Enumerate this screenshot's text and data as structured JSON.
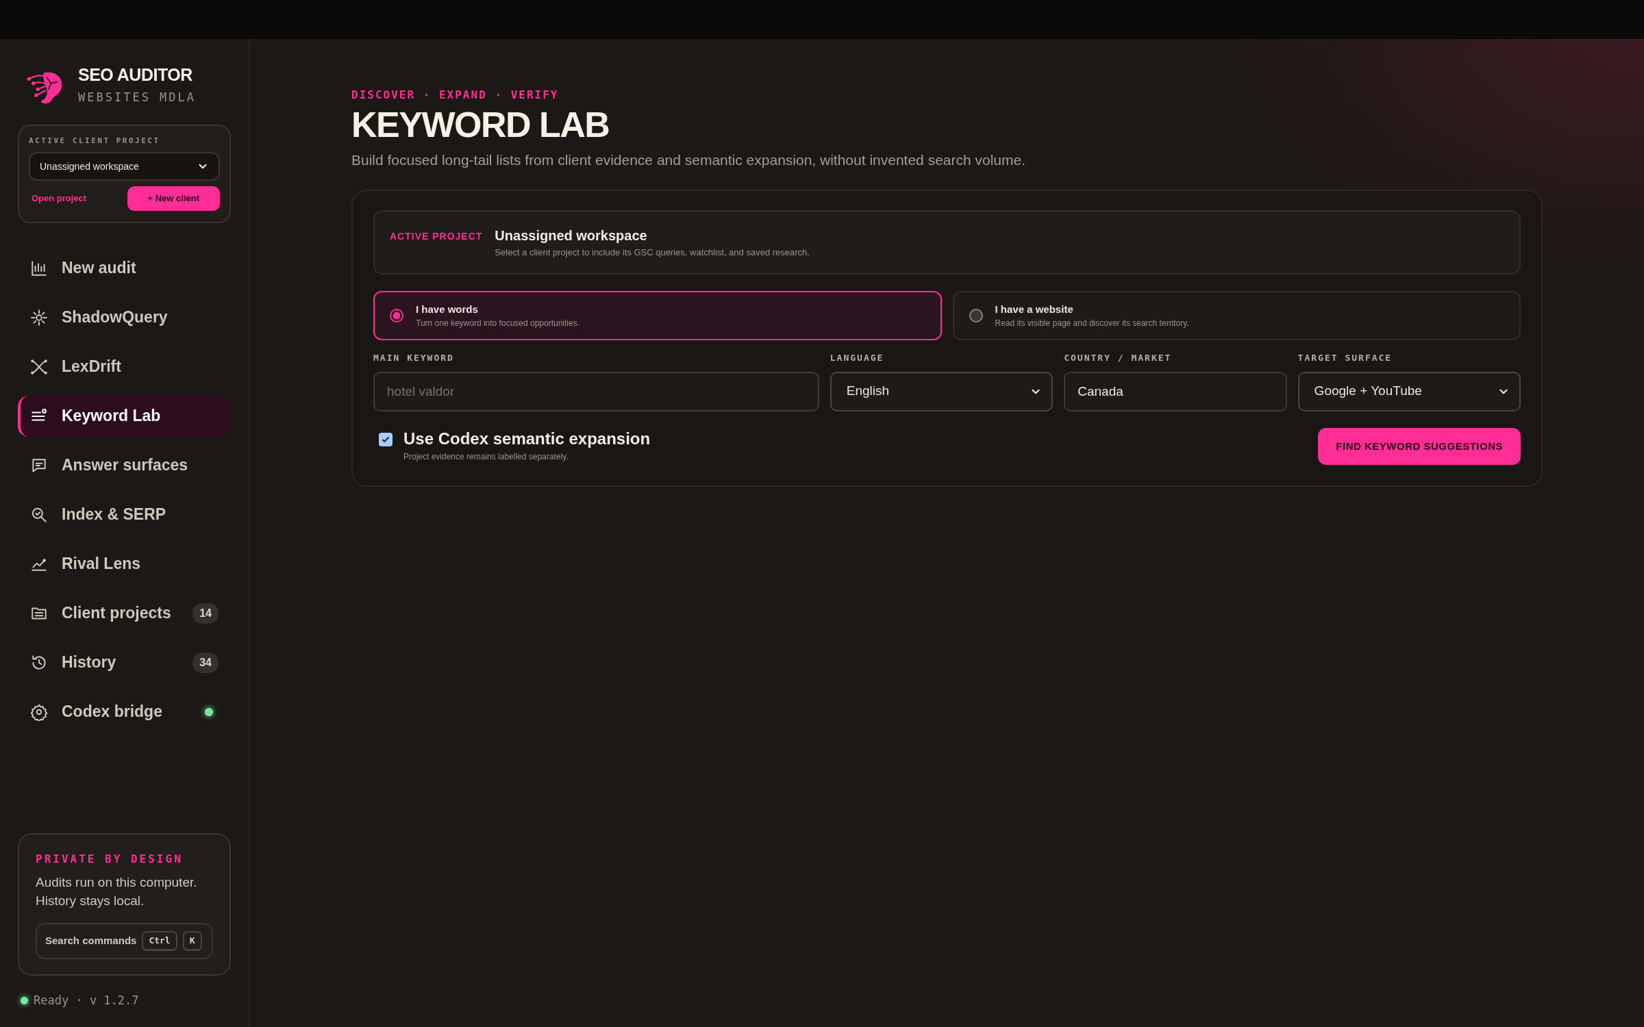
{
  "brand": {
    "name": "SEO AUDITOR",
    "subtitle": "WEBSITES MDLA"
  },
  "project_picker": {
    "label": "ACTIVE CLIENT PROJECT",
    "value": "Unassigned workspace",
    "open_link": "Open project",
    "new_button": "+ New client"
  },
  "nav": [
    {
      "label": "New audit",
      "kind": "plain",
      "selected": false
    },
    {
      "label": "ShadowQuery",
      "kind": "plain",
      "selected": false
    },
    {
      "label": "LexDrift",
      "kind": "plain",
      "selected": false
    },
    {
      "label": "Keyword Lab",
      "kind": "plain",
      "selected": true
    },
    {
      "label": "Answer surfaces",
      "kind": "plain",
      "selected": false
    },
    {
      "label": "Index & SERP",
      "kind": "plain",
      "selected": false
    },
    {
      "label": "Rival Lens",
      "kind": "plain",
      "selected": false
    },
    {
      "label": "Client projects",
      "kind": "count",
      "badge": "14",
      "selected": false
    },
    {
      "label": "History",
      "kind": "count",
      "badge": "34",
      "selected": false
    },
    {
      "label": "Codex bridge",
      "kind": "status",
      "online": true,
      "selected": false
    }
  ],
  "privacy": {
    "title": "PRIVATE BY DESIGN",
    "text": "Audits run on this computer. History stays local.",
    "search_label": "Search commands",
    "keys": [
      "Ctrl",
      "K"
    ]
  },
  "status": {
    "online": true,
    "text": "Ready · v 1.2.7"
  },
  "header": {
    "eyebrow": "DISCOVER · EXPAND · VERIFY",
    "title": "KEYWORD LAB",
    "subtitle": "Build focused long-tail lists from client evidence and semantic expansion, without invented search volume."
  },
  "active_project": {
    "label": "ACTIVE PROJECT",
    "name": "Unassigned workspace",
    "hint": "Select a client project to include its GSC queries, watchlist, and saved research."
  },
  "modes": [
    {
      "title": "I have words",
      "description": "Turn one keyword into focused opportunities.",
      "selected": true
    },
    {
      "title": "I have a website",
      "description": "Read its visible page and discover its search territory.",
      "selected": false
    }
  ],
  "fields": [
    {
      "kind": "input",
      "label": "MAIN KEYWORD",
      "placeholder": "hotel valdor"
    },
    {
      "kind": "select",
      "label": "LANGUAGE",
      "value": "English"
    },
    {
      "kind": "input",
      "label": "COUNTRY / MARKET",
      "value": "Canada"
    },
    {
      "kind": "select",
      "label": "TARGET SURFACE",
      "value": "Google + YouTube"
    }
  ],
  "semantic": {
    "label": "Use Codex semantic expansion",
    "hint": "Project evidence remains labelled separately.",
    "checked": true
  },
  "submit": "FIND KEYWORD SUGGESTIONS"
}
